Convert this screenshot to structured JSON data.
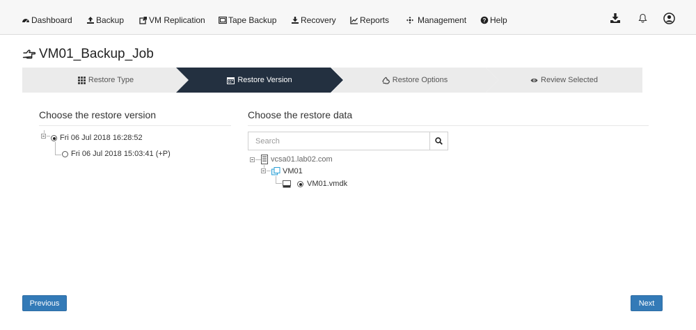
{
  "nav": {
    "items": [
      {
        "label": "Dashboard",
        "icon": "dashboard-icon"
      },
      {
        "label": "Backup",
        "icon": "upload-icon"
      },
      {
        "label": "VM Replication",
        "icon": "share-icon"
      },
      {
        "label": "Tape Backup",
        "icon": "tape-icon"
      },
      {
        "label": "Recovery",
        "icon": "download-icon"
      },
      {
        "label": "Reports",
        "icon": "chart-icon"
      },
      {
        "label": "Management",
        "icon": "management-icon"
      },
      {
        "label": "Help",
        "icon": "help-icon"
      }
    ],
    "right_icons": [
      "download-icon",
      "bell-icon",
      "user-icon"
    ]
  },
  "page": {
    "title": "VM01_Backup_Job",
    "title_icon": "hand-pointer-icon"
  },
  "wizard": {
    "steps": [
      {
        "label": "Restore Type",
        "icon": "grid-icon",
        "active": false
      },
      {
        "label": "Restore Version",
        "icon": "calendar-icon",
        "active": true
      },
      {
        "label": "Restore Options",
        "icon": "recycle-icon",
        "active": false
      },
      {
        "label": "Review Selected",
        "icon": "eye-icon",
        "active": false
      }
    ]
  },
  "versions": {
    "title": "Choose the restore version",
    "items": [
      {
        "label": "Fri 06 Jul 2018 16:28:52",
        "selected": true
      },
      {
        "label": "Fri 06 Jul 2018 15:03:41 (+P)",
        "selected": false
      }
    ]
  },
  "restore_data": {
    "title": "Choose the restore data",
    "search_placeholder": "Search",
    "host": "vcsa01.lab02.com",
    "vm": "VM01",
    "disk": "VM01.vmdk"
  },
  "buttons": {
    "previous": "Previous",
    "next": "Next"
  },
  "colors": {
    "active_step": "#233040",
    "inactive_step": "#ebebeb",
    "button": "#337ab7"
  }
}
